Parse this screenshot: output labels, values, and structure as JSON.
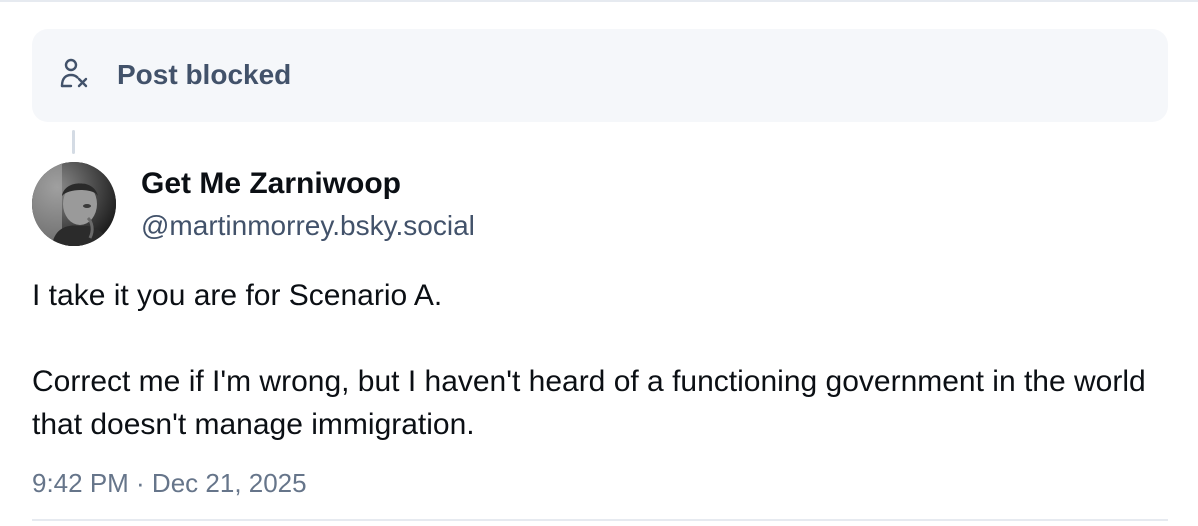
{
  "blocked_notice": {
    "icon": "person-x-icon",
    "label": "Post blocked"
  },
  "post": {
    "author": {
      "display_name": "Get Me Zarniwoop",
      "handle": "@martinmorrey.bsky.social",
      "avatar": "avatar-photo"
    },
    "text_paragraphs": [
      "I take it you are for Scenario A.",
      "Correct me if I'm wrong, but I haven't heard of a functioning government in the world that doesn't manage immigration."
    ],
    "timestamp": "9:42 PM · Dec 21, 2025"
  },
  "colors": {
    "card_background": "#f5f7fa",
    "muted_text": "#42526a",
    "meta_text": "#66758a",
    "divider": "#e6eaf0"
  }
}
